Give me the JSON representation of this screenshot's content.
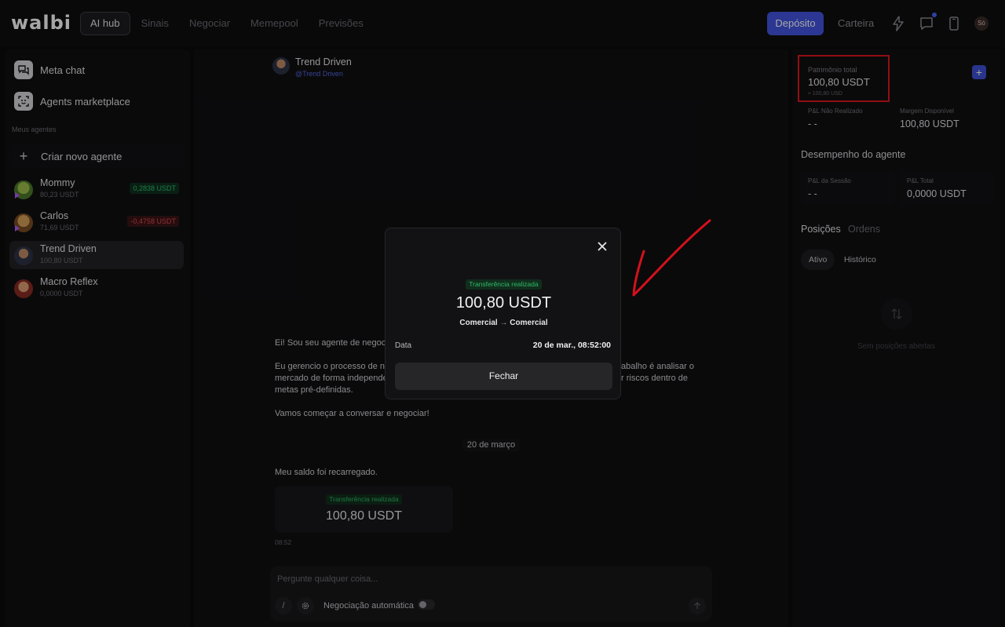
{
  "app": {
    "logo": "walbi"
  },
  "nav": {
    "items": [
      {
        "label": "AI hub",
        "active": true
      },
      {
        "label": "Sinais",
        "active": false
      },
      {
        "label": "Negociar",
        "active": false
      },
      {
        "label": "Memepool",
        "active": false
      },
      {
        "label": "Previsões",
        "active": false
      }
    ],
    "deposit_label": "Depósito",
    "wallet_label": "Carteira",
    "user_initials": "Só"
  },
  "sidebar": {
    "links": [
      {
        "label": "Meta chat",
        "icon": "chat-bubbles-icon"
      },
      {
        "label": "Agents marketplace",
        "icon": "agent-face-icon"
      }
    ],
    "section_title": "Meus agentes",
    "new_agent_label": "Criar novo agente",
    "agents": [
      {
        "name": "Mommy",
        "balance": "80,23 USDT",
        "pnl": "0,2838 USDT",
        "pnl_sign": "positive",
        "running": true,
        "selected": false
      },
      {
        "name": "Carlos",
        "balance": "71,69 USDT",
        "pnl": "-0,4758 USDT",
        "pnl_sign": "negative",
        "running": true,
        "selected": false
      },
      {
        "name": "Trend Driven",
        "balance": "100,80 USDT",
        "pnl": "",
        "pnl_sign": "",
        "running": false,
        "selected": true
      },
      {
        "name": "Macro Reflex",
        "balance": "0,0000 USDT",
        "pnl": "",
        "pnl_sign": "",
        "running": false,
        "selected": false
      }
    ]
  },
  "chat": {
    "agent_name": "Trend Driven",
    "agent_handle": "@Trend Driven",
    "intro_line1": "Ei! Sou seu agente de negocia",
    "intro_para_lines": [
      "Eu gerencio o processo de ne",
      "mercado de forma independer",
      "metas pré-definidas."
    ],
    "intro_para_right": [
      "abalho é analisar o",
      "r riscos dentro de"
    ],
    "intro_close": "Vamos começar a conversar e negociar!",
    "date_separator": "20 de março",
    "user_message": "Meu saldo foi recarregado.",
    "transfer_card": {
      "badge": "Transferência realizada",
      "amount": "100,80 USDT"
    },
    "message_time": "08:52",
    "composer": {
      "placeholder": "Pergunte qualquer coisa...",
      "slash_label": "/",
      "auto_trade_label": "Negociação automática",
      "auto_trade_on": false
    }
  },
  "modal": {
    "badge": "Transferência realizada",
    "amount": "100,80 USDT",
    "from": "Comercial",
    "arrow": "→",
    "to": "Comercial",
    "date_label": "Data",
    "date_value": "20 de mar., 08:52:00",
    "close_button": "Fechar"
  },
  "right_panel": {
    "equity_label": "Patrimônio total",
    "equity_value": "100,80 USDT",
    "equity_sub": "≈ 100,80 USD",
    "unrealized_label": "P&L Não Realizado",
    "unrealized_value": "- -",
    "margin_label": "Margem Disponível",
    "margin_value": "100,80 USDT",
    "performance_title": "Desempenho do agente",
    "session_pnl_label": "P&L da Sessão",
    "session_pnl_value": "- -",
    "total_pnl_label": "P&L Total",
    "total_pnl_value": "0,0000 USDT",
    "tabs": [
      "Posições",
      "Ordens"
    ],
    "sub_tabs": [
      "Ativo",
      "Histórico"
    ],
    "empty_text": "Sem posições abertas"
  },
  "colors": {
    "accent": "#4255e0",
    "positive": "#2fbf6a",
    "negative": "#e04a4f",
    "highlight_box": "#e0161e",
    "annotation_check": "#d3111b"
  }
}
